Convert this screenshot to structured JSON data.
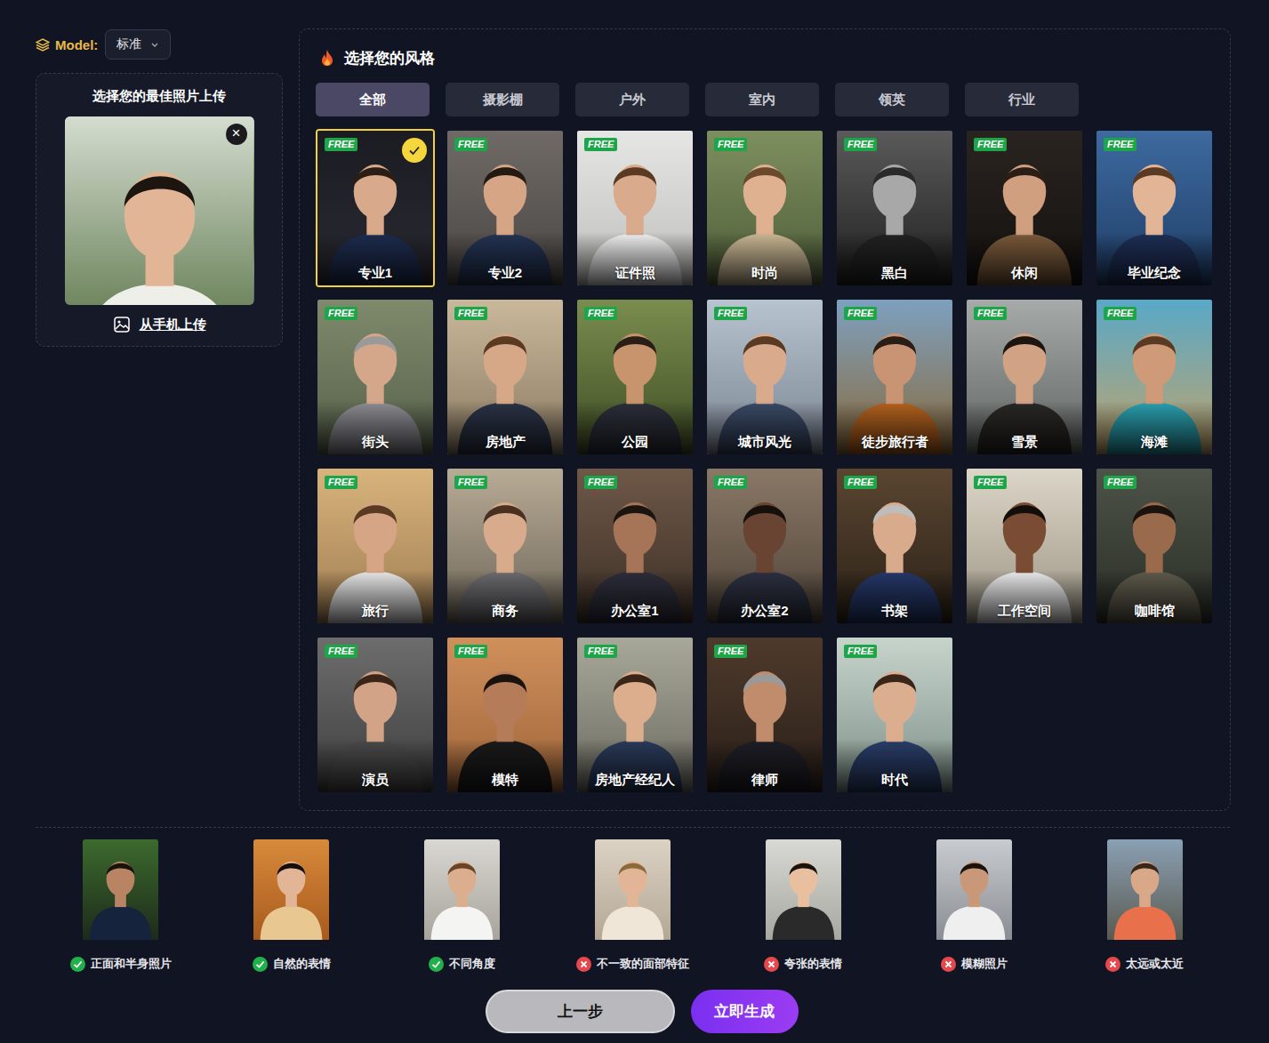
{
  "model": {
    "label": "Model:",
    "value": "标准"
  },
  "upload": {
    "title": "选择您的最佳照片上传",
    "remove": "×",
    "link": "从手机上传"
  },
  "styles": {
    "title": "选择您的风格",
    "tabs": [
      {
        "label": "全部",
        "selected": true
      },
      {
        "label": "摄影棚",
        "selected": false
      },
      {
        "label": "户外",
        "selected": false
      },
      {
        "label": "室内",
        "selected": false
      },
      {
        "label": "领英",
        "selected": false
      },
      {
        "label": "行业",
        "selected": false
      }
    ],
    "cards": [
      {
        "badge": "FREE",
        "label": "专业1",
        "selected": true
      },
      {
        "badge": "FREE",
        "label": "专业2",
        "selected": false
      },
      {
        "badge": "FREE",
        "label": "证件照",
        "selected": false
      },
      {
        "badge": "FREE",
        "label": "时尚",
        "selected": false
      },
      {
        "badge": "FREE",
        "label": "黑白",
        "selected": false
      },
      {
        "badge": "FREE",
        "label": "休闲",
        "selected": false
      },
      {
        "badge": "FREE",
        "label": "毕业纪念",
        "selected": false
      },
      {
        "badge": "FREE",
        "label": "街头",
        "selected": false
      },
      {
        "badge": "FREE",
        "label": "房地产",
        "selected": false
      },
      {
        "badge": "FREE",
        "label": "公园",
        "selected": false
      },
      {
        "badge": "FREE",
        "label": "城市风光",
        "selected": false
      },
      {
        "badge": "FREE",
        "label": "徒步旅行者",
        "selected": false
      },
      {
        "badge": "FREE",
        "label": "雪景",
        "selected": false
      },
      {
        "badge": "FREE",
        "label": "海滩",
        "selected": false
      },
      {
        "badge": "FREE",
        "label": "旅行",
        "selected": false
      },
      {
        "badge": "FREE",
        "label": "商务",
        "selected": false
      },
      {
        "badge": "FREE",
        "label": "办公室1",
        "selected": false
      },
      {
        "badge": "FREE",
        "label": "办公室2",
        "selected": false
      },
      {
        "badge": "FREE",
        "label": "书架",
        "selected": false
      },
      {
        "badge": "FREE",
        "label": "工作空间",
        "selected": false
      },
      {
        "badge": "FREE",
        "label": "咖啡馆",
        "selected": false
      },
      {
        "badge": "FREE",
        "label": "演员",
        "selected": false
      },
      {
        "badge": "FREE",
        "label": "模特",
        "selected": false
      },
      {
        "badge": "FREE",
        "label": "房地产经纪人",
        "selected": false
      },
      {
        "badge": "FREE",
        "label": "律师",
        "selected": false
      },
      {
        "badge": "FREE",
        "label": "时代",
        "selected": false
      }
    ]
  },
  "tips": [
    {
      "label": "正面和半身照片",
      "ok": true
    },
    {
      "label": "自然的表情",
      "ok": true
    },
    {
      "label": "不同角度",
      "ok": true
    },
    {
      "label": "不一致的面部特征",
      "ok": false
    },
    {
      "label": "夸张的表情",
      "ok": false
    },
    {
      "label": "模糊照片",
      "ok": false
    },
    {
      "label": "太远或太近",
      "ok": false
    }
  ],
  "buttons": [
    {
      "label": "上一步",
      "kind": "secondary"
    },
    {
      "label": "立即生成",
      "kind": "primary"
    }
  ]
}
